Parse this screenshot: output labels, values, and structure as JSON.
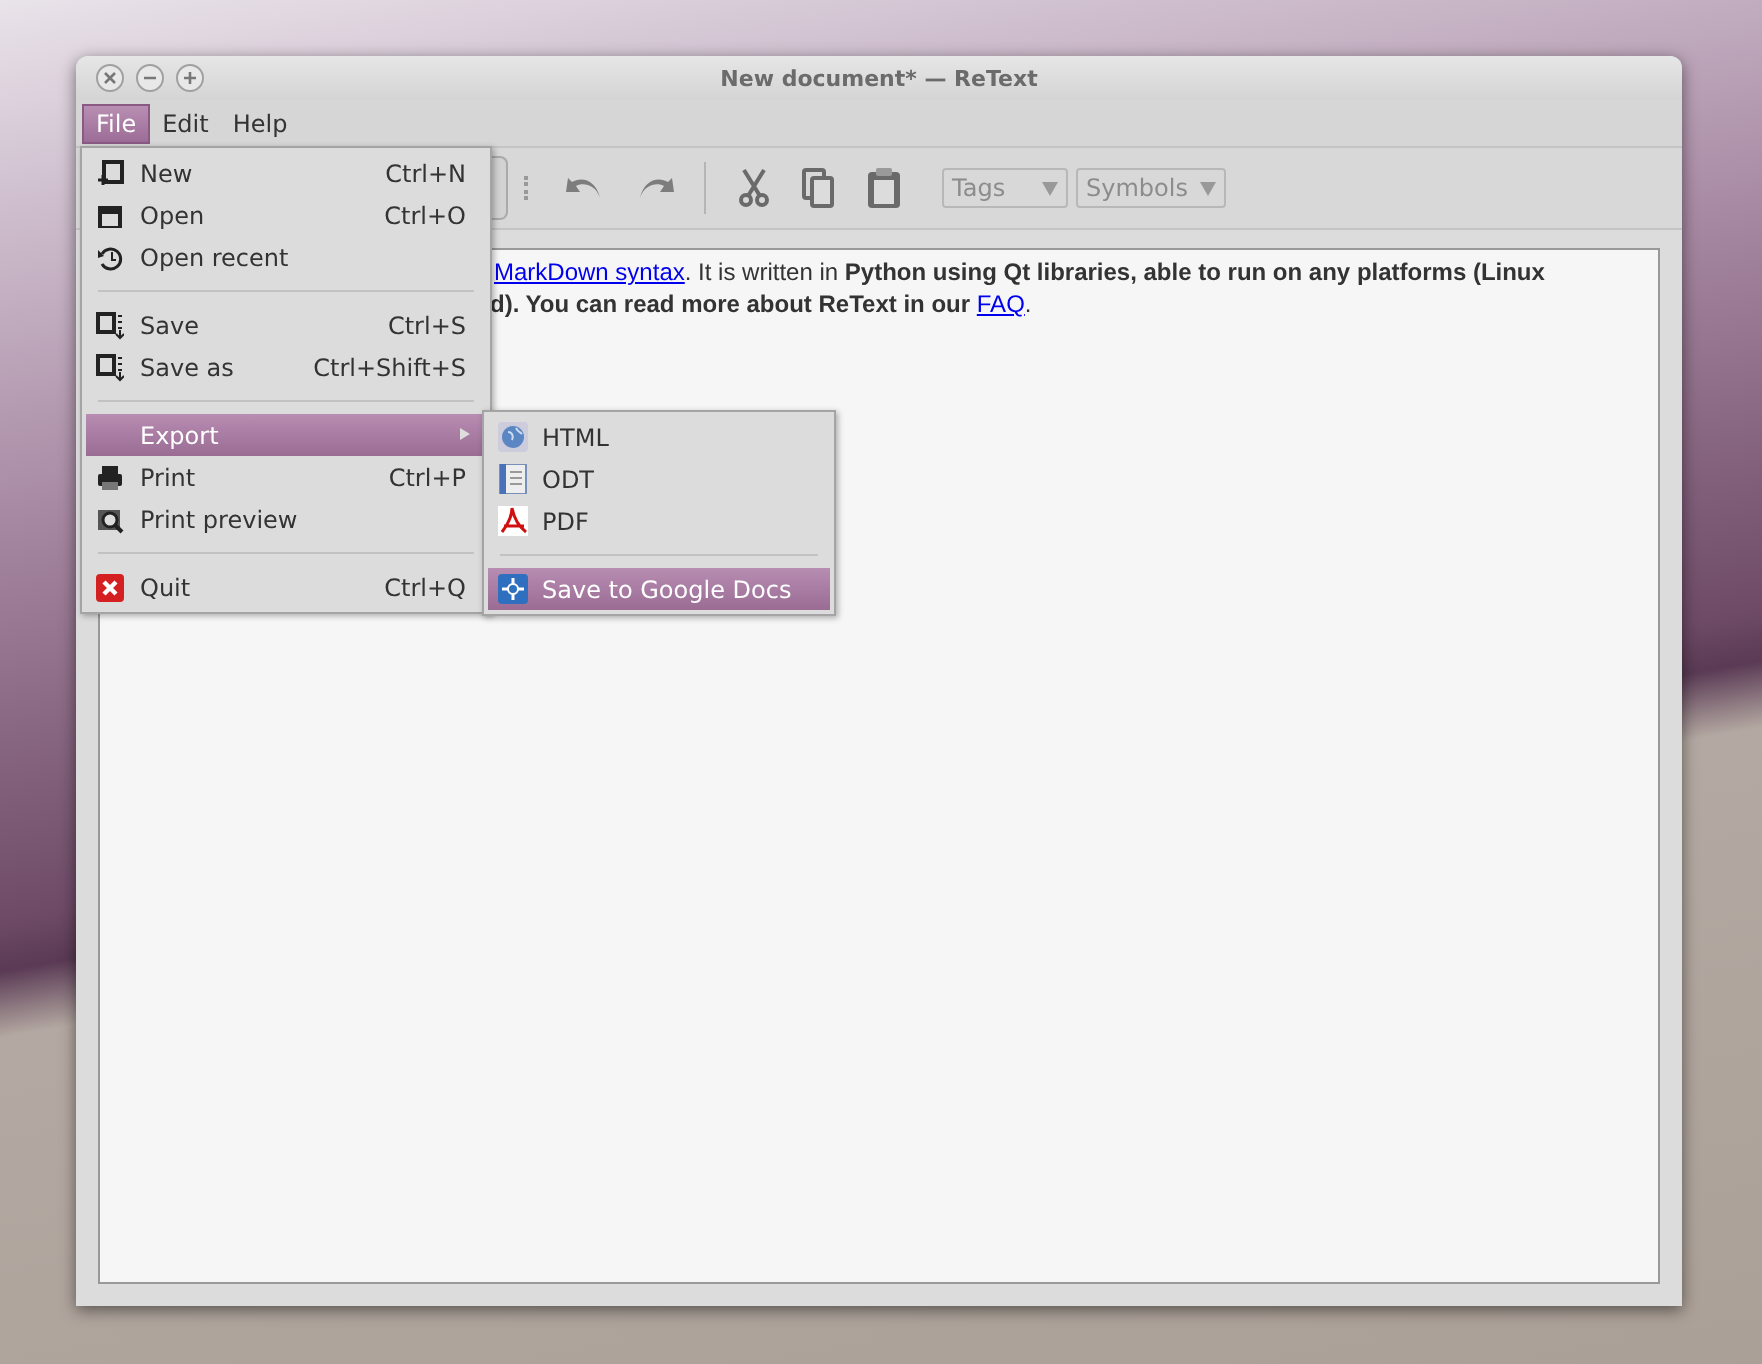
{
  "window": {
    "title": "New document* — ReText"
  },
  "menu_bar": [
    {
      "label": "File",
      "selected": true
    },
    {
      "label": "Edit",
      "selected": false
    },
    {
      "label": "Help",
      "selected": false
    }
  ],
  "toolbar": {
    "combos": [
      {
        "label": "Tags",
        "disabled": true
      },
      {
        "label": "Symbols",
        "disabled": true
      }
    ]
  },
  "editor": {
    "lines": [
      [
        {
          "kind": "link",
          "text": "MarkDown syntax"
        },
        {
          "kind": "text",
          "text": ". It is written in **Python using Qt libraries, able to run on any platforms (Linux**"
        }
      ],
      [
        {
          "kind": "text",
          "text": "**d). You can read more about ReText in our** "
        },
        {
          "kind": "link",
          "text": "FAQ"
        },
        {
          "kind": "text",
          "text": "."
        }
      ]
    ]
  },
  "file_menu": [
    {
      "kind": "item",
      "label": "New",
      "shortcut": "Ctrl+N",
      "selected": false
    },
    {
      "kind": "item",
      "label": "Open",
      "shortcut": "Ctrl+O",
      "selected": false
    },
    {
      "kind": "item",
      "label": "Open recent",
      "selected": false
    },
    {
      "kind": "separator"
    },
    {
      "kind": "item",
      "label": "Save",
      "shortcut": "Ctrl+S",
      "selected": false
    },
    {
      "kind": "item",
      "label": "Save as",
      "shortcut": "Ctrl+Shift+S",
      "selected": false
    },
    {
      "kind": "separator"
    },
    {
      "kind": "submenu",
      "label": "Export",
      "selected": true
    },
    {
      "kind": "item",
      "label": "Print",
      "shortcut": "Ctrl+P",
      "selected": false
    },
    {
      "kind": "item",
      "label": "Print preview",
      "selected": false
    },
    {
      "kind": "separator"
    },
    {
      "kind": "item",
      "label": "Quit",
      "shortcut": "Ctrl+Q",
      "selected": false
    }
  ],
  "export_menu": [
    {
      "kind": "item",
      "label": "HTML",
      "selected": false
    },
    {
      "kind": "item",
      "label": "ODT",
      "selected": false
    },
    {
      "kind": "item",
      "label": "PDF",
      "selected": false
    },
    {
      "kind": "separator"
    },
    {
      "kind": "item",
      "label": "Save to Google Docs",
      "selected": true
    }
  ]
}
